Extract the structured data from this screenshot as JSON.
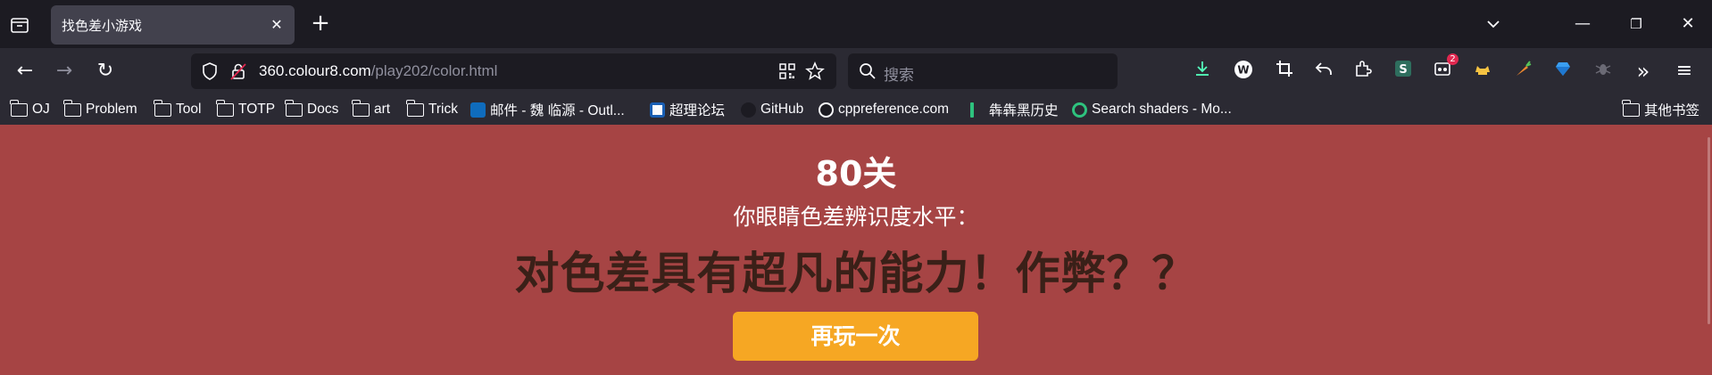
{
  "tabs": [
    {
      "title": "找色差小游戏",
      "close_glyph": "✕"
    }
  ],
  "window": {
    "newtab_glyph": "+",
    "minimize_glyph": "—",
    "restore_glyph": "❐",
    "close_glyph": "✕"
  },
  "nav": {
    "back_glyph": "←",
    "forward_glyph": "→",
    "reload_glyph": "↻",
    "url_host": "360.colour8.com",
    "url_path": "/play202/color.html",
    "search_placeholder": "搜索",
    "extensions_badge": "2",
    "overflow_glyph": "»",
    "menu_glyph": "≡"
  },
  "bookmarks": [
    {
      "label": "OJ",
      "icon": "folder-icon"
    },
    {
      "label": "Problem",
      "icon": "folder-icon"
    },
    {
      "label": "Tool",
      "icon": "folder-icon"
    },
    {
      "label": "TOTP",
      "icon": "folder-icon"
    },
    {
      "label": "Docs",
      "icon": "folder-icon"
    },
    {
      "label": "art",
      "icon": "folder-icon"
    },
    {
      "label": "Trick",
      "icon": "folder-icon"
    },
    {
      "label": "邮件 - 魏 临源 - Outl...",
      "icon": "outlook-icon"
    },
    {
      "label": "超理论坛",
      "icon": "forum-icon"
    },
    {
      "label": "GitHub",
      "icon": "github-icon"
    },
    {
      "label": "cppreference.com",
      "icon": "cppreference-icon"
    },
    {
      "label": "犇犇黑历史",
      "icon": "page-icon"
    },
    {
      "label": "Search shaders - Mo...",
      "icon": "shadertoy-icon"
    }
  ],
  "other_bookmarks": "其他书签",
  "game": {
    "level": "80关",
    "subtitle": "你眼睛色差辨识度水平：",
    "result": "对色差具有超凡的能力！作弊？？",
    "replay_label": "再玩一次"
  },
  "colors": {
    "page_bg": "#a64444",
    "result_text": "#3a2018",
    "replay_bg": "#f6a723",
    "chrome_dark": "#1c1b22",
    "toolbar": "#2b2a33",
    "tab_active": "#42414d"
  }
}
